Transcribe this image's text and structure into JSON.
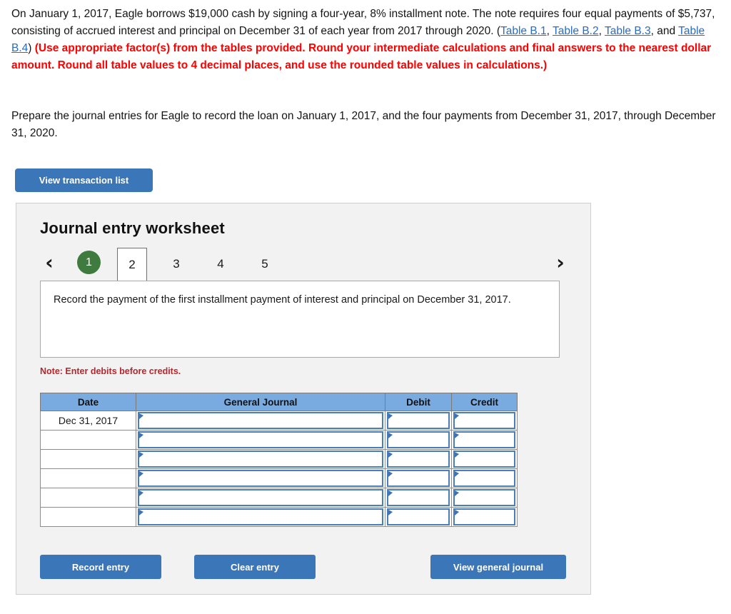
{
  "problem": {
    "paragraph1_part1": "On January 1, 2017, Eagle borrows $19,000 cash by signing a four-year, 8% installment note. The note requires four equal payments of $5,737, consisting of accrued interest and principal on December 31 of each year from 2017 through 2020. (",
    "links": [
      "Table B.1",
      "Table B.2",
      "Table B.3",
      "Table B.4"
    ],
    "sep_comma": ", ",
    "sep_and": ", and ",
    "paragraph1_part2": ") ",
    "paragraph1_red": "(Use appropriate factor(s) from the tables provided. Round your intermediate calculations and final answers to the nearest dollar amount. Round all table values to 4 decimal places, and use the rounded table values in calculations.)",
    "paragraph2": "Prepare the journal entries for Eagle to record the loan on January 1, 2017, and the four payments from December 31, 2017, through December 31, 2020."
  },
  "toolbar": {
    "view_transaction_list_label": "View transaction list"
  },
  "worksheet": {
    "title": "Journal entry worksheet",
    "nav": {
      "prev_icon": "chevron-left-icon",
      "next_icon": "chevron-right-icon",
      "prev_glyph": "‹",
      "next_glyph": "›"
    },
    "tabs": [
      {
        "label": "1",
        "state": "done"
      },
      {
        "label": "2",
        "state": "current"
      },
      {
        "label": "3",
        "state": "default"
      },
      {
        "label": "4",
        "state": "default"
      },
      {
        "label": "5",
        "state": "default"
      }
    ],
    "instruction": "Record the payment of the first installment payment of interest and principal on December 31, 2017.",
    "note": "Note: Enter debits before credits.",
    "table": {
      "headers": [
        "Date",
        "General Journal",
        "Debit",
        "Credit"
      ],
      "rows": [
        {
          "date": "Dec 31, 2017",
          "general_journal": "",
          "debit": "",
          "credit": ""
        },
        {
          "date": "",
          "general_journal": "",
          "debit": "",
          "credit": ""
        },
        {
          "date": "",
          "general_journal": "",
          "debit": "",
          "credit": ""
        },
        {
          "date": "",
          "general_journal": "",
          "debit": "",
          "credit": ""
        },
        {
          "date": "",
          "general_journal": "",
          "debit": "",
          "credit": ""
        },
        {
          "date": "",
          "general_journal": "",
          "debit": "",
          "credit": ""
        }
      ]
    },
    "actions": {
      "record_entry_label": "Record entry",
      "clear_entry_label": "Clear entry",
      "view_general_journal_label": "View general journal"
    }
  },
  "colors": {
    "button_blue": "#3b76b8",
    "tab_done_green": "#3f7a3f",
    "table_header_blue": "#7aabe0",
    "input_border_blue": "#4a7ebb",
    "instruction_red": "#ff0000",
    "note_red": "#b5272d",
    "link_blue": "#2a6bc4",
    "panel_bg": "#f2f2f2"
  }
}
